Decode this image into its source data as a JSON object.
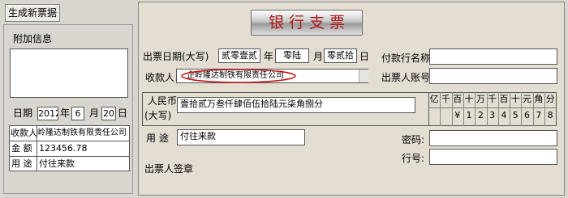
{
  "toolbar": {
    "generate_button": "生成新票据"
  },
  "stub": {
    "title": "附加信息",
    "date_label": "日期",
    "year": "2012",
    "year_unit": "年",
    "month": "6",
    "month_unit": "月",
    "day": "20",
    "day_unit": "日",
    "rows": [
      {
        "label": "收款人",
        "value": "岭隆达制铁有限责任公司"
      },
      {
        "label": "金 额",
        "value": "123456.78"
      },
      {
        "label": "用 途",
        "value": "付往来款"
      }
    ]
  },
  "cheque": {
    "title": "银 行 支 票",
    "issue_date_label": "出票日期(大写)",
    "year_value": "贰零壹贰",
    "year_unit": "年",
    "month_value": "零陆",
    "month_unit": "月",
    "day_value": "零贰拾",
    "day_unit": "日",
    "payee_label": "收款人",
    "payee_value": "企岭隆达制铁有限责任公司",
    "payer_bank_label": "付款行名称",
    "payer_bank_value": "",
    "payer_account_label": "出票人账号",
    "payer_account_value": "",
    "rmb_label_1": "人民币",
    "rmb_label_2": "(大写)",
    "amount_words": "壹拾贰万叁仟肆佰伍拾陆元柒角捌分",
    "unit_headers": [
      "亿",
      "千",
      "百",
      "十",
      "万",
      "千",
      "百",
      "十",
      "元",
      "角",
      "分"
    ],
    "amount_digits": [
      "",
      "",
      "¥",
      "1",
      "2",
      "3",
      "4",
      "5",
      "6",
      "7",
      "8"
    ],
    "purpose_label": "用  途",
    "purpose_value": "付往来款",
    "password_label": "密码:",
    "password_value": "",
    "line_label": "行号:",
    "line_value": "",
    "signature_label": "出票人签章"
  }
}
